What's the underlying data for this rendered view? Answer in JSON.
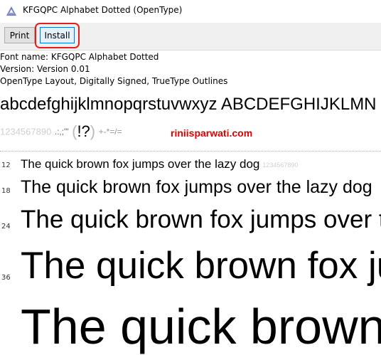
{
  "window": {
    "title": "KFGQPC Alphabet Dotted (OpenType)",
    "icon": "font-file-icon"
  },
  "toolbar": {
    "print_label": "Print",
    "install_label": "Install"
  },
  "font_info": {
    "name_line": "Font name: KFGQPC Alphabet Dotted",
    "version_line": "Version: Version 0.01",
    "type_line": "OpenType Layout, Digitally Signed, TrueType Outlines"
  },
  "preview": {
    "alphabet": "abcdefghijklmnopqrstuvwxyz ABCDEFGHIJKLMN",
    "digits_dotted": "1234567890",
    "punct_1": ".:,;'\"",
    "paren_open": "(",
    "question": "!?",
    "paren_close": ")",
    "symbols": "+-*=/=",
    "watermark": "riniisparwati.com"
  },
  "samples": [
    {
      "size": "12",
      "text": "The quick brown fox jumps over the lazy dog",
      "tail": "1234567890"
    },
    {
      "size": "18",
      "text": "The quick brown fox jumps over the lazy dog",
      "tail": ""
    },
    {
      "size": "24",
      "text": "The quick brown fox jumps over the lazy dog",
      "tail": ""
    },
    {
      "size": "36",
      "text": "The quick brown fox jumps over the lazy dog",
      "tail": ""
    },
    {
      "size": "",
      "text": "The quick brown fox jumps over the lazy dog",
      "tail": ""
    }
  ],
  "colors": {
    "highlight": "#e02020",
    "watermark": "#e00000",
    "toolbar_bg": "#f0f0f0"
  }
}
